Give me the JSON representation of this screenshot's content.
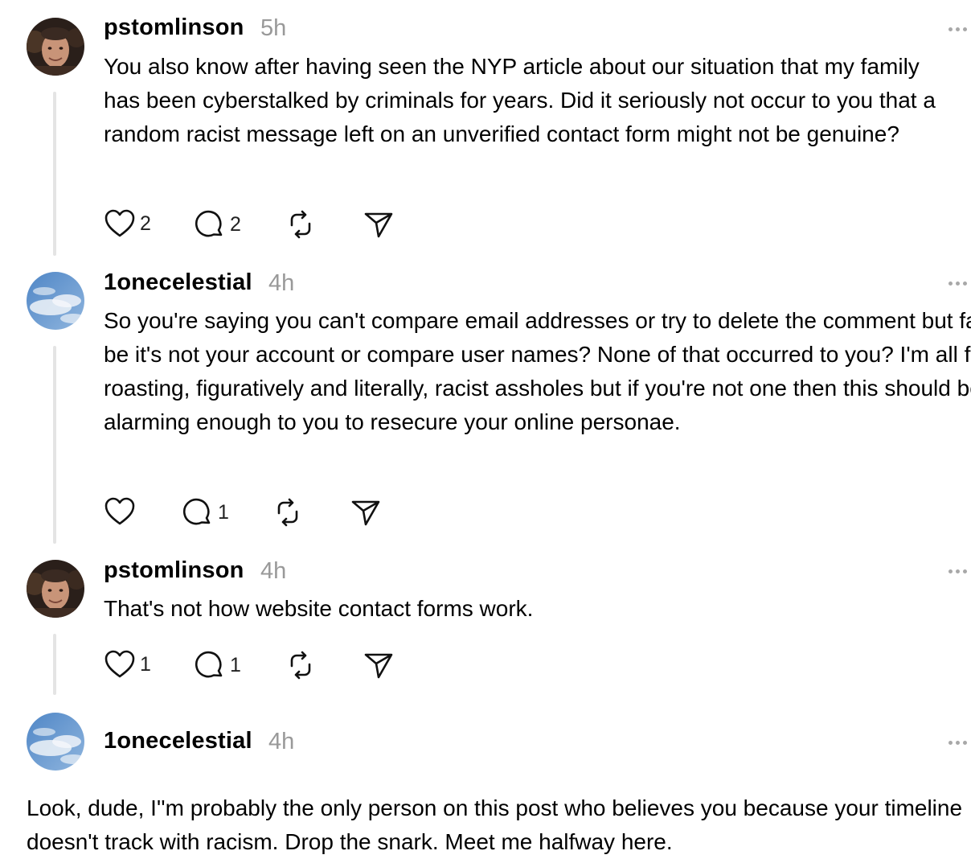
{
  "posts": [
    {
      "username": "pstomlinson",
      "time": "5h",
      "text": "You also know after having seen the NYP article about our situation that my family has been cyberstalked by criminals for years. Did it seriously not occur to you that a random racist message left on an unverified contact form might not be genuine?",
      "like_count": "2",
      "reply_count": "2",
      "avatar": "man-avatar"
    },
    {
      "username": "1onecelestial",
      "time": "4h",
      "text": "So you're saying you can't compare email addresses or try to delete the comment but fail be it's not your account or compare user names? None of that occurred to you? I'm all for roasting, figuratively and literally, racist assholes but if you're not one then this should be alarming enough to you to resecure your online personae.",
      "like_count": "",
      "reply_count": "1",
      "avatar": "sky-avatar"
    },
    {
      "username": "pstomlinson",
      "time": "4h",
      "text": "That's not how website contact forms work.",
      "like_count": "1",
      "reply_count": "1",
      "avatar": "man-avatar"
    },
    {
      "username": "1onecelestial",
      "time": "4h",
      "text": "Look, dude, I''m probably the only person on this post who believes you because your timeline doesn't track with racism. Drop the snark. Meet me halfway here.",
      "avatar": "sky-avatar"
    }
  ],
  "icons": {
    "like": "heart-icon",
    "reply": "comment-icon",
    "repost": "repost-icon",
    "share": "send-icon",
    "more": "more-icon"
  },
  "colors": {
    "text": "#000000",
    "muted": "#999999",
    "thread_line": "#e4e4e4"
  }
}
